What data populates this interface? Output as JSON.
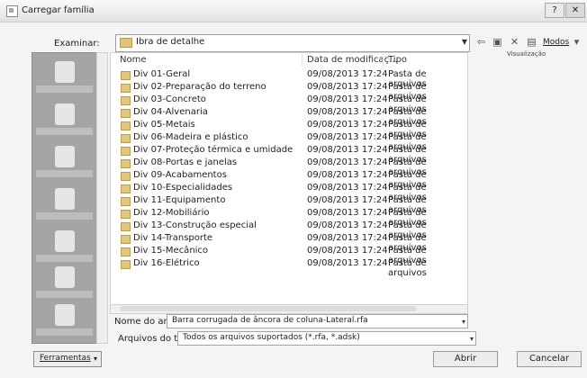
{
  "window": {
    "title": "Carregar família",
    "help_glyph": "?",
    "close_glyph": "✕"
  },
  "toolbar": {
    "look_in_label": "Examinar:",
    "look_in_value": "Ibra de detalhe",
    "views_label": "Modos",
    "preview_label": "Visualização"
  },
  "places_bar": {
    "items": [
      {
        "icon": "computer-icon"
      },
      {
        "icon": "library-icon"
      },
      {
        "icon": "user-icon"
      },
      {
        "icon": "network-icon"
      },
      {
        "icon": "folder-icon"
      },
      {
        "icon": "desktop-icon"
      },
      {
        "icon": "favorites-icon"
      }
    ]
  },
  "file_list": {
    "columns": [
      "Nome",
      "Data de modificaç...",
      "Tipo"
    ],
    "rows": [
      {
        "name": "Div 01-Geral",
        "date": "09/08/2013 17:24",
        "type": "Pasta de arquivos"
      },
      {
        "name": "Div 02-Preparação do terreno",
        "date": "09/08/2013 17:24",
        "type": "Pasta de arquivos"
      },
      {
        "name": "Div 03-Concreto",
        "date": "09/08/2013 17:24",
        "type": "Pasta de arquivos"
      },
      {
        "name": "Div 04-Alvenaria",
        "date": "09/08/2013 17:24",
        "type": "Pasta de arquivos"
      },
      {
        "name": "Div 05-Metais",
        "date": "09/08/2013 17:24",
        "type": "Pasta de arquivos"
      },
      {
        "name": "Div 06-Madeira e plástico",
        "date": "09/08/2013 17:24",
        "type": "Pasta de arquivos"
      },
      {
        "name": "Div 07-Proteção térmica e umidade",
        "date": "09/08/2013 17:24",
        "type": "Pasta de arquivos"
      },
      {
        "name": "Div 08-Portas e janelas",
        "date": "09/08/2013 17:24",
        "type": "Pasta de arquivos"
      },
      {
        "name": "Div 09-Acabamentos",
        "date": "09/08/2013 17:24",
        "type": "Pasta de arquivos"
      },
      {
        "name": "Div 10-Especialidades",
        "date": "09/08/2013 17:24",
        "type": "Pasta de arquivos"
      },
      {
        "name": "Div 11-Equipamento",
        "date": "09/08/2013 17:24",
        "type": "Pasta de arquivos"
      },
      {
        "name": "Div 12-Mobiliário",
        "date": "09/08/2013 17:24",
        "type": "Pasta de arquivos"
      },
      {
        "name": "Div 13-Construção especial",
        "date": "09/08/2013 17:24",
        "type": "Pasta de arquivos"
      },
      {
        "name": "Div 14-Transporte",
        "date": "09/08/2013 17:24",
        "type": "Pasta de arquivos"
      },
      {
        "name": "Div 15-Mecânico",
        "date": "09/08/2013 17:24",
        "type": "Pasta de arquivos"
      },
      {
        "name": "Div 16-Elétrico",
        "date": "09/08/2013 17:24",
        "type": "Pasta de arquivos"
      }
    ]
  },
  "file_name": {
    "label": "Nome do arquivo:",
    "value": "Barra corrugada de âncora de coluna-Lateral.rfa"
  },
  "file_type": {
    "label": "Arquivos do tipo:",
    "value": "Todos os arquivos suportados (*.rfa, *.adsk)"
  },
  "buttons": {
    "tools": "Ferramentas",
    "open": "Abrir",
    "cancel": "Cancelar"
  }
}
